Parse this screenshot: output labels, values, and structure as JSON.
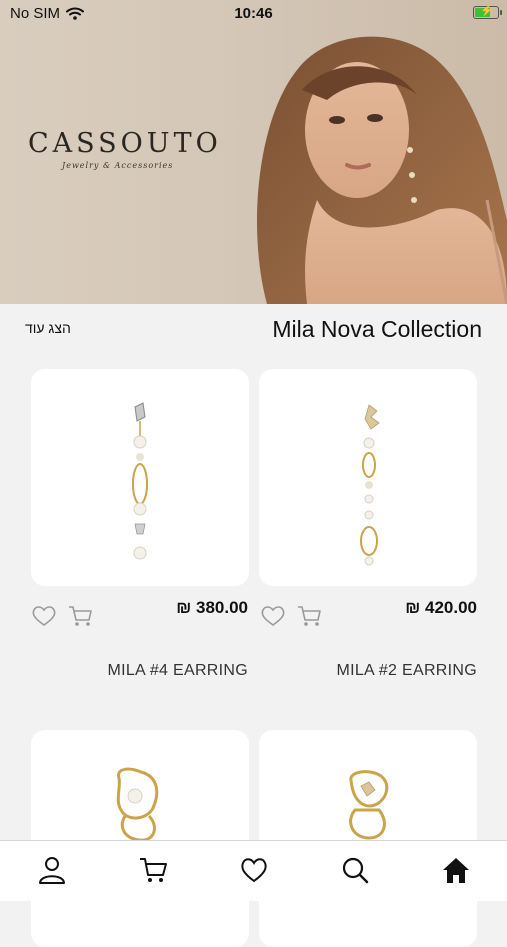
{
  "status": {
    "carrier": "No SIM",
    "time": "10:46",
    "battery_level": 0.7,
    "battery_color": "#3cc13b"
  },
  "hero": {
    "brand": "CASSOUTO",
    "tagline": "Jewelry & Accessories"
  },
  "section": {
    "title": "Mila Nova Collection",
    "show_more": "הצג עוד"
  },
  "products": [
    {
      "name": "MILA #4 EARRING",
      "price": "₪ 380.00"
    },
    {
      "name": "MILA #2 EARRING",
      "price": "₪ 420.00"
    }
  ],
  "tabbar": {
    "items": [
      "profile-icon",
      "cart-icon",
      "heart-icon",
      "search-icon",
      "home-icon"
    ],
    "active": "home-icon"
  }
}
